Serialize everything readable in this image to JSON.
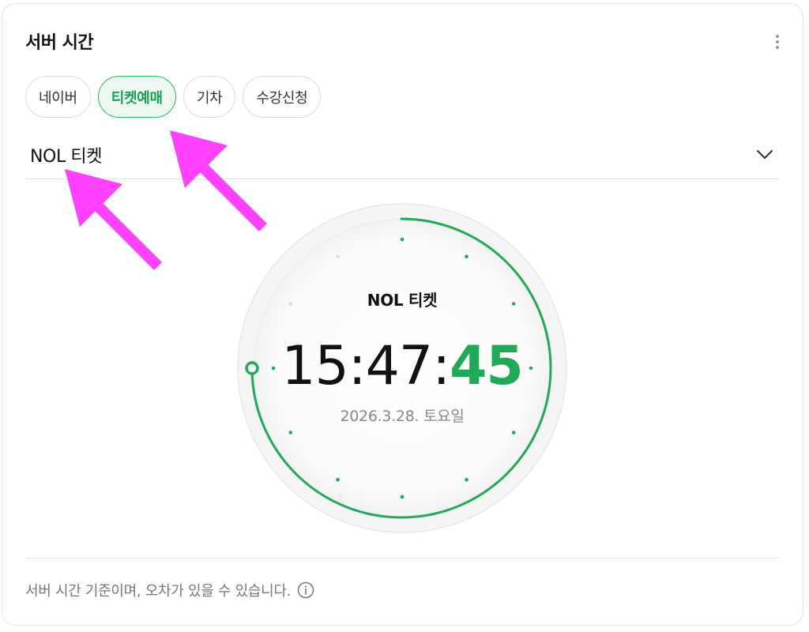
{
  "header": {
    "title": "서버 시간",
    "more_icon": "more-vertical-icon"
  },
  "tabs": [
    {
      "label": "네이버",
      "active": false
    },
    {
      "label": "티켓예매",
      "active": true
    },
    {
      "label": "기차",
      "active": false
    },
    {
      "label": "수강신청",
      "active": false
    }
  ],
  "site_select": {
    "value": "NOL 티켓",
    "icon": "chevron-down-icon"
  },
  "clock": {
    "site_label": "NOL 티켓",
    "hours_minutes": "15:47:",
    "seconds": "45",
    "date": "2026.3.28. 토요일"
  },
  "footer": {
    "notice": "서버 시간 기준이며, 오차가 있을 수 있습니다.",
    "info_icon": "info-icon"
  },
  "colors": {
    "accent": "#1faa57",
    "annotation_arrow": "#ff40ff"
  }
}
